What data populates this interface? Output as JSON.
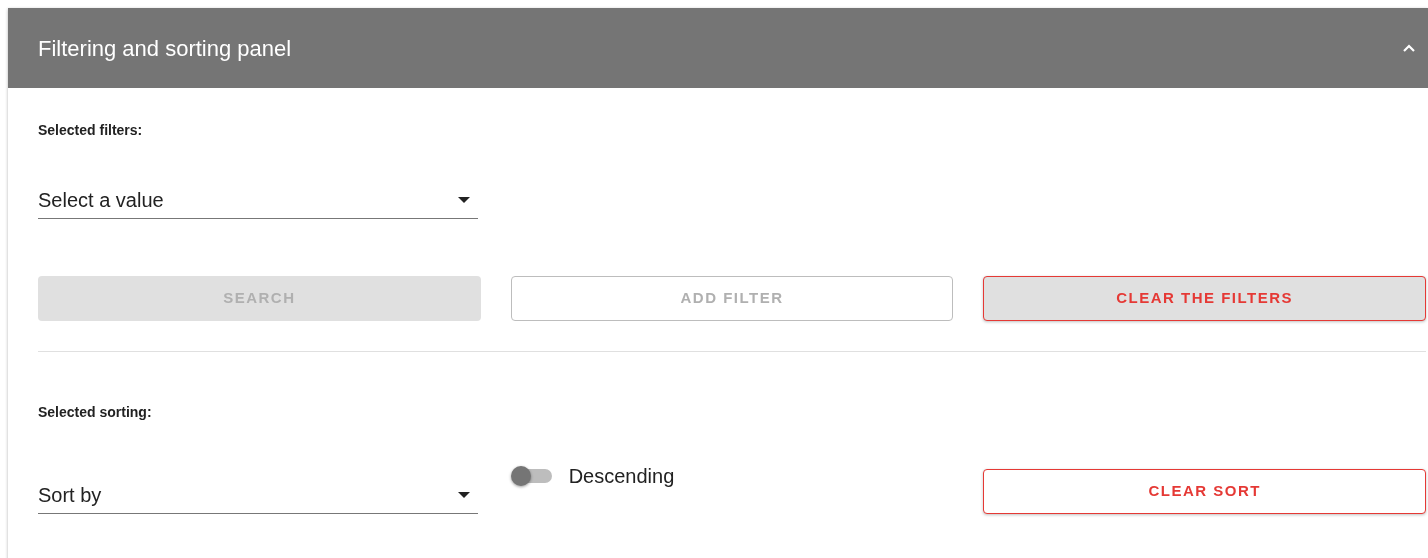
{
  "panel": {
    "title": "Filtering and sorting panel",
    "expanded": true
  },
  "filters": {
    "heading": "Selected filters:",
    "select": {
      "placeholder": "Select a value"
    },
    "buttons": [
      {
        "label": "SEARCH",
        "kind": "filled",
        "disabled": true,
        "focused": false
      },
      {
        "label": "ADD FILTER",
        "kind": "outlined",
        "disabled": true,
        "focused": false
      },
      {
        "label": "CLEAR THE FILTERS",
        "kind": "outlined",
        "disabled": false,
        "focused": true
      }
    ]
  },
  "sorting": {
    "heading": "Selected sorting:",
    "select": {
      "placeholder": "Sort by"
    },
    "toggle": {
      "label": "Descending",
      "on": false
    },
    "button": {
      "label": "CLEAR SORT",
      "kind": "outlined",
      "disabled": false,
      "focused": false
    }
  }
}
